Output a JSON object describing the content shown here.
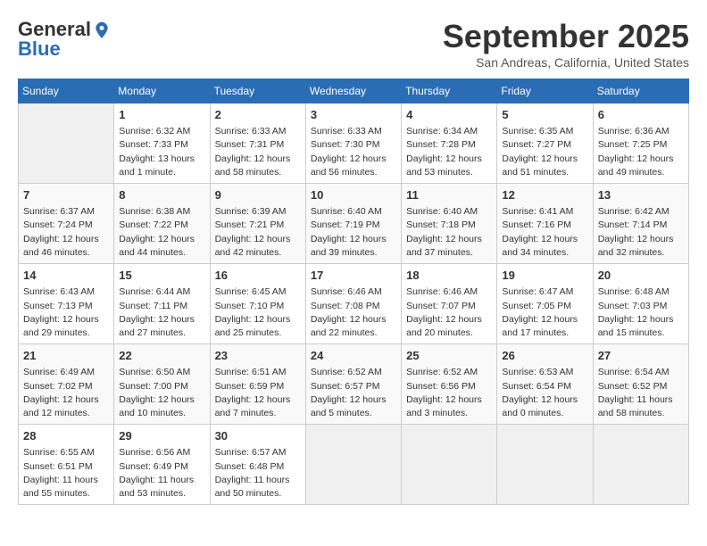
{
  "logo": {
    "general": "General",
    "blue": "Blue"
  },
  "header": {
    "month": "September 2025",
    "location": "San Andreas, California, United States"
  },
  "days_of_week": [
    "Sunday",
    "Monday",
    "Tuesday",
    "Wednesday",
    "Thursday",
    "Friday",
    "Saturday"
  ],
  "weeks": [
    [
      {
        "day": "",
        "info": ""
      },
      {
        "day": "1",
        "info": "Sunrise: 6:32 AM\nSunset: 7:33 PM\nDaylight: 13 hours\nand 1 minute."
      },
      {
        "day": "2",
        "info": "Sunrise: 6:33 AM\nSunset: 7:31 PM\nDaylight: 12 hours\nand 58 minutes."
      },
      {
        "day": "3",
        "info": "Sunrise: 6:33 AM\nSunset: 7:30 PM\nDaylight: 12 hours\nand 56 minutes."
      },
      {
        "day": "4",
        "info": "Sunrise: 6:34 AM\nSunset: 7:28 PM\nDaylight: 12 hours\nand 53 minutes."
      },
      {
        "day": "5",
        "info": "Sunrise: 6:35 AM\nSunset: 7:27 PM\nDaylight: 12 hours\nand 51 minutes."
      },
      {
        "day": "6",
        "info": "Sunrise: 6:36 AM\nSunset: 7:25 PM\nDaylight: 12 hours\nand 49 minutes."
      }
    ],
    [
      {
        "day": "7",
        "info": "Sunrise: 6:37 AM\nSunset: 7:24 PM\nDaylight: 12 hours\nand 46 minutes."
      },
      {
        "day": "8",
        "info": "Sunrise: 6:38 AM\nSunset: 7:22 PM\nDaylight: 12 hours\nand 44 minutes."
      },
      {
        "day": "9",
        "info": "Sunrise: 6:39 AM\nSunset: 7:21 PM\nDaylight: 12 hours\nand 42 minutes."
      },
      {
        "day": "10",
        "info": "Sunrise: 6:40 AM\nSunset: 7:19 PM\nDaylight: 12 hours\nand 39 minutes."
      },
      {
        "day": "11",
        "info": "Sunrise: 6:40 AM\nSunset: 7:18 PM\nDaylight: 12 hours\nand 37 minutes."
      },
      {
        "day": "12",
        "info": "Sunrise: 6:41 AM\nSunset: 7:16 PM\nDaylight: 12 hours\nand 34 minutes."
      },
      {
        "day": "13",
        "info": "Sunrise: 6:42 AM\nSunset: 7:14 PM\nDaylight: 12 hours\nand 32 minutes."
      }
    ],
    [
      {
        "day": "14",
        "info": "Sunrise: 6:43 AM\nSunset: 7:13 PM\nDaylight: 12 hours\nand 29 minutes."
      },
      {
        "day": "15",
        "info": "Sunrise: 6:44 AM\nSunset: 7:11 PM\nDaylight: 12 hours\nand 27 minutes."
      },
      {
        "day": "16",
        "info": "Sunrise: 6:45 AM\nSunset: 7:10 PM\nDaylight: 12 hours\nand 25 minutes."
      },
      {
        "day": "17",
        "info": "Sunrise: 6:46 AM\nSunset: 7:08 PM\nDaylight: 12 hours\nand 22 minutes."
      },
      {
        "day": "18",
        "info": "Sunrise: 6:46 AM\nSunset: 7:07 PM\nDaylight: 12 hours\nand 20 minutes."
      },
      {
        "day": "19",
        "info": "Sunrise: 6:47 AM\nSunset: 7:05 PM\nDaylight: 12 hours\nand 17 minutes."
      },
      {
        "day": "20",
        "info": "Sunrise: 6:48 AM\nSunset: 7:03 PM\nDaylight: 12 hours\nand 15 minutes."
      }
    ],
    [
      {
        "day": "21",
        "info": "Sunrise: 6:49 AM\nSunset: 7:02 PM\nDaylight: 12 hours\nand 12 minutes."
      },
      {
        "day": "22",
        "info": "Sunrise: 6:50 AM\nSunset: 7:00 PM\nDaylight: 12 hours\nand 10 minutes."
      },
      {
        "day": "23",
        "info": "Sunrise: 6:51 AM\nSunset: 6:59 PM\nDaylight: 12 hours\nand 7 minutes."
      },
      {
        "day": "24",
        "info": "Sunrise: 6:52 AM\nSunset: 6:57 PM\nDaylight: 12 hours\nand 5 minutes."
      },
      {
        "day": "25",
        "info": "Sunrise: 6:52 AM\nSunset: 6:56 PM\nDaylight: 12 hours\nand 3 minutes."
      },
      {
        "day": "26",
        "info": "Sunrise: 6:53 AM\nSunset: 6:54 PM\nDaylight: 12 hours\nand 0 minutes."
      },
      {
        "day": "27",
        "info": "Sunrise: 6:54 AM\nSunset: 6:52 PM\nDaylight: 11 hours\nand 58 minutes."
      }
    ],
    [
      {
        "day": "28",
        "info": "Sunrise: 6:55 AM\nSunset: 6:51 PM\nDaylight: 11 hours\nand 55 minutes."
      },
      {
        "day": "29",
        "info": "Sunrise: 6:56 AM\nSunset: 6:49 PM\nDaylight: 11 hours\nand 53 minutes."
      },
      {
        "day": "30",
        "info": "Sunrise: 6:57 AM\nSunset: 6:48 PM\nDaylight: 11 hours\nand 50 minutes."
      },
      {
        "day": "",
        "info": ""
      },
      {
        "day": "",
        "info": ""
      },
      {
        "day": "",
        "info": ""
      },
      {
        "day": "",
        "info": ""
      }
    ]
  ]
}
